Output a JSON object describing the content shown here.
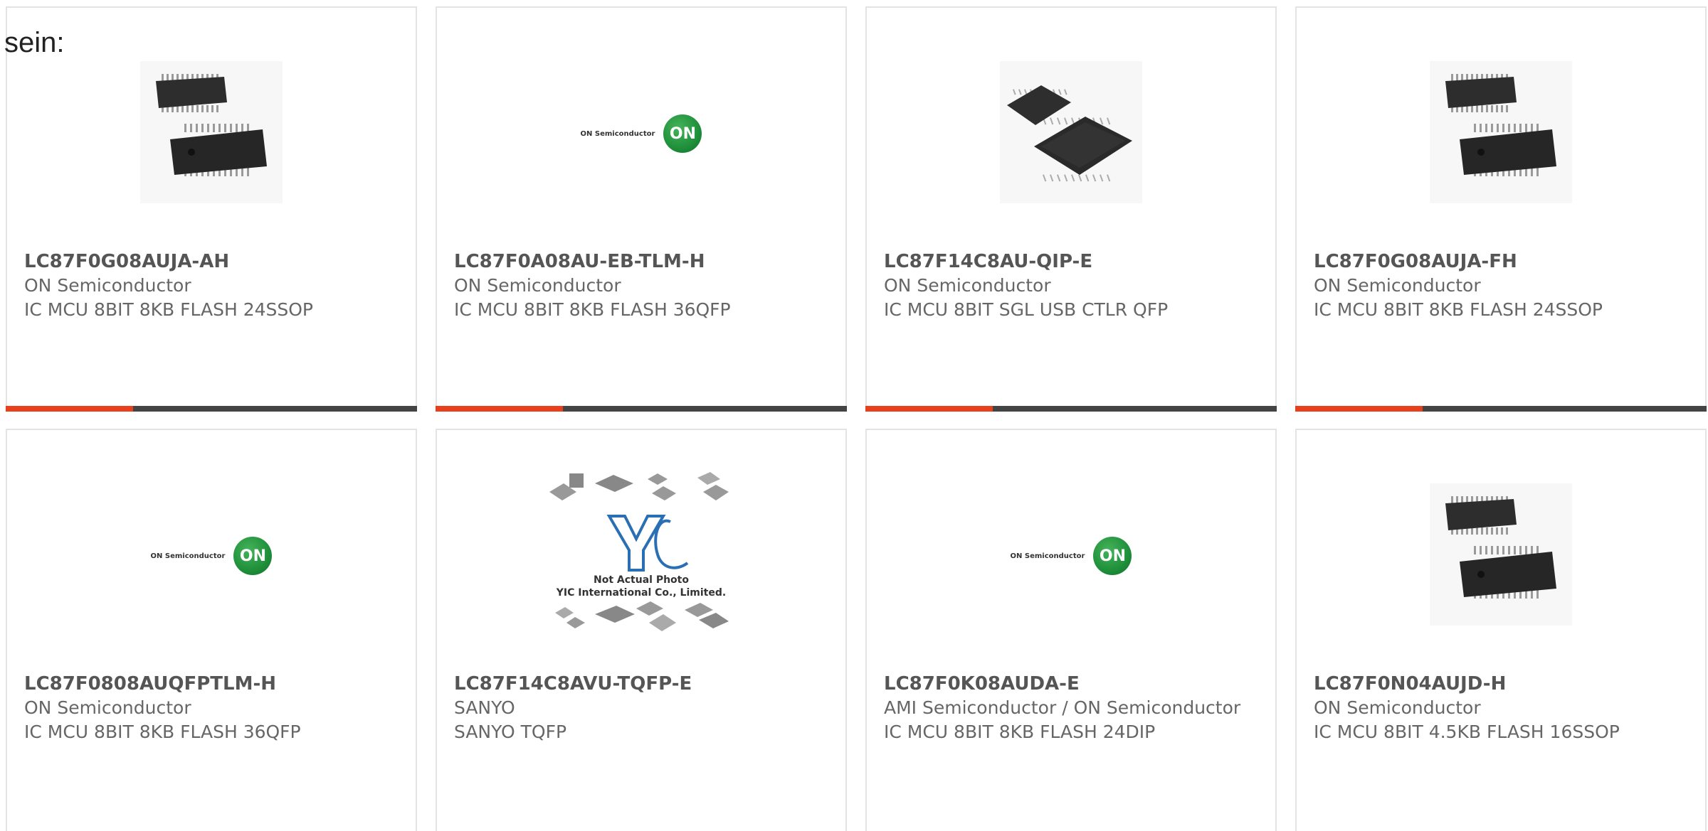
{
  "intro": "sein:",
  "colors": {
    "accent": "#e8401c",
    "bar_track": "#444444",
    "on_logo_green": "#1f8f3a"
  },
  "products": [
    {
      "part": "LC87F0G08AUJA-AH",
      "manufacturer": "ON Semiconductor",
      "description": "IC MCU 8BIT 8KB FLASH 24SSOP",
      "image": "ssop-chip-icon",
      "progress": 0.31
    },
    {
      "part": "LC87F0A08AU-EB-TLM-H",
      "manufacturer": "ON Semiconductor",
      "description": "IC MCU 8BIT 8KB FLASH 36QFP",
      "image": "on-semiconductor-logo",
      "logo_text": "ON Semiconductor",
      "logo_badge": "ON",
      "progress": 0.31
    },
    {
      "part": "LC87F14C8AU-QIP-E",
      "manufacturer": "ON Semiconductor",
      "description": "IC MCU 8BIT SGL USB CTLR QFP",
      "image": "qfp-chip-icon",
      "progress": 0.31
    },
    {
      "part": "LC87F0G08AUJA-FH",
      "manufacturer": "ON Semiconductor",
      "description": "IC MCU 8BIT 8KB FLASH 24SSOP",
      "image": "ssop-chip-icon",
      "progress": 0.31
    },
    {
      "part": "LC87F0808AUQFPTLM-H",
      "manufacturer": "ON Semiconductor",
      "description": "IC MCU 8BIT 8KB FLASH 36QFP",
      "image": "on-semiconductor-logo",
      "logo_text": "ON Semiconductor",
      "logo_badge": "ON"
    },
    {
      "part": "LC87F14C8AVU-TQFP-E",
      "manufacturer": "SANYO",
      "description": "SANYO TQFP",
      "image": "yic-placeholder",
      "placeholder_logo": "YIC",
      "placeholder_line1": "Not Actual Photo",
      "placeholder_line2": "YIC International Co., Limited."
    },
    {
      "part": "LC87F0K08AUDA-E",
      "manufacturer": "AMI Semiconductor / ON Semiconductor",
      "description": "IC MCU 8BIT 8KB FLASH 24DIP",
      "image": "on-semiconductor-logo",
      "logo_text": "ON Semiconductor",
      "logo_badge": "ON"
    },
    {
      "part": "LC87F0N04AUJD-H",
      "manufacturer": "ON Semiconductor",
      "description": "IC MCU 8BIT 4.5KB FLASH 16SSOP",
      "image": "ssop-chip-icon"
    }
  ]
}
